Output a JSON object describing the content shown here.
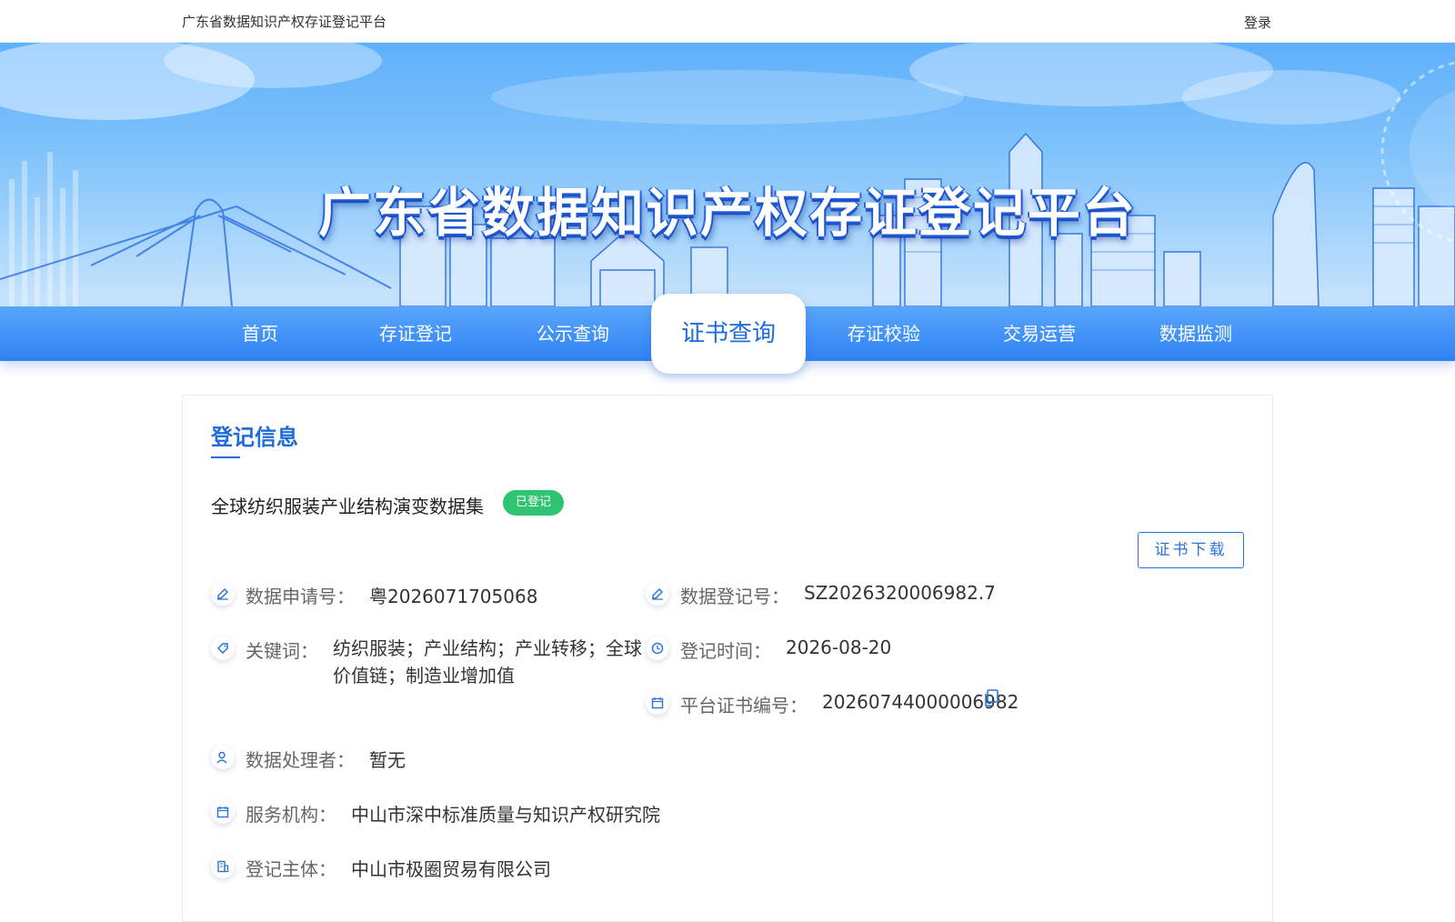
{
  "topbar": {
    "site_name": "广东省数据知识产权存证登记平台",
    "login": "登录"
  },
  "banner": {
    "title": "广东省数据知识产权存证登记平台"
  },
  "nav": {
    "items": [
      "首页",
      "存证登记",
      "公示查询",
      "证书查询",
      "存证校验",
      "交易运营",
      "数据监测"
    ],
    "active_index": 3
  },
  "record": {
    "section_title": "登记信息",
    "dataset_name": "全球纺织服装产业结构演变数据集",
    "status": "已登记",
    "download_button": "证书下载",
    "fields": {
      "apply_no": {
        "label": "数据申请号：",
        "value": "粤2026071705068"
      },
      "register_no": {
        "label": "数据登记号：",
        "value": "SZ2026320006982.7"
      },
      "keywords": {
        "label": "关键词：",
        "value": "纺织服装；产业结构；产业转移；全球价值链；制造业增加值"
      },
      "register_time": {
        "label": "登记时间：",
        "value": "2026-08-20"
      },
      "cert_no": {
        "label": "平台证书编号：",
        "value": "20260744000006982"
      },
      "processor": {
        "label": "数据处理者：",
        "value": "暂无"
      },
      "service_org": {
        "label": "服务机构：",
        "value": "中山市深中标准质量与知识产权研究院"
      },
      "subject": {
        "label": "登记主体：",
        "value": "中山市极圈贸易有限公司"
      }
    }
  },
  "colors": {
    "primary": "#1f6bd8",
    "nav_gradient_top": "#5aa6fb",
    "nav_gradient_bottom": "#2f82f3",
    "badge_green": "#2fc472"
  },
  "icons": [
    "edit-icon",
    "tag-icon",
    "clock-icon",
    "calendar-icon",
    "user-icon",
    "building-icon",
    "copy-icon"
  ]
}
